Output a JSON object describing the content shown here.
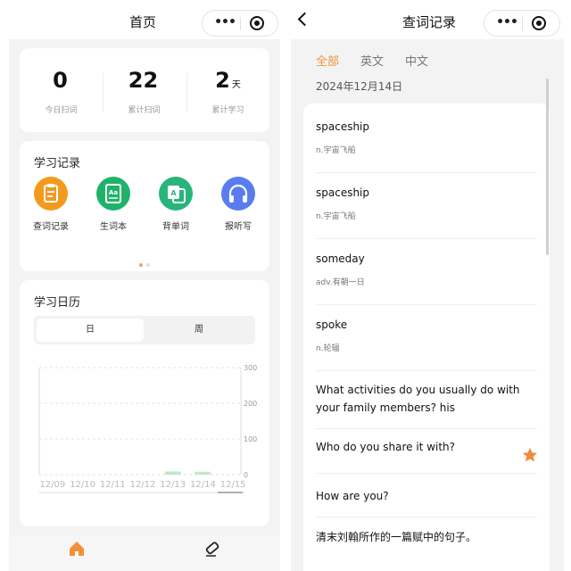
{
  "home": {
    "title": "首页",
    "stats": [
      {
        "value": "0",
        "unit": "",
        "label": "今日扫词"
      },
      {
        "value": "22",
        "unit": "",
        "label": "累计扫词"
      },
      {
        "value": "2",
        "unit": "天",
        "label": "累计学习"
      }
    ],
    "record": {
      "title": "学习记录",
      "features": [
        {
          "label": "查词记录",
          "icon": "clipboard-icon",
          "color": "#f39a1d"
        },
        {
          "label": "生词本",
          "icon": "vocab-book-icon",
          "color": "#1fb36a"
        },
        {
          "label": "背单词",
          "icon": "flashcard-icon",
          "color": "#27b57c"
        },
        {
          "label": "报听写",
          "icon": "headphones-icon",
          "color": "#5b7cf0"
        }
      ],
      "page_index": 0,
      "page_count": 2
    },
    "calendar": {
      "title": "学习日历",
      "tabs": [
        "日",
        "周"
      ],
      "active_tab": 0
    }
  },
  "chart_data": {
    "type": "bar",
    "categories": [
      "12/09",
      "12/10",
      "12/11",
      "12/12",
      "12/13",
      "12/14",
      "12/15"
    ],
    "values": [
      0,
      0,
      0,
      0,
      4,
      3,
      0
    ],
    "ylim": [
      0,
      300
    ],
    "yticks": [
      "0",
      "100",
      "200",
      "300"
    ],
    "grid": true,
    "bar_color": "#bfe9c9"
  },
  "history": {
    "title": "查词记录",
    "filters": [
      "全部",
      "英文",
      "中文"
    ],
    "active_filter": 0,
    "date": "2024年12月14日",
    "items": [
      {
        "word": "spaceship",
        "definition": "n.宇宙飞船",
        "starred": false
      },
      {
        "word": "spaceship",
        "definition": "n.宇宙飞船",
        "starred": false
      },
      {
        "word": "someday",
        "definition": "adv.有朝一日",
        "starred": false
      },
      {
        "word": "spoke",
        "definition": "n.轮辐",
        "starred": false
      },
      {
        "word": "What activities do you usually do with your family members? his",
        "definition": "",
        "starred": false
      },
      {
        "word": "Who do you share it with?",
        "definition": "",
        "starred": true
      },
      {
        "word": "How are you?",
        "definition": "",
        "starred": false
      },
      {
        "word": "清末刘翰所作的一篇赋中的句子。",
        "definition": "",
        "starred": false
      }
    ]
  },
  "colors": {
    "accent": "#f0913a",
    "star": "#f08a3c"
  }
}
